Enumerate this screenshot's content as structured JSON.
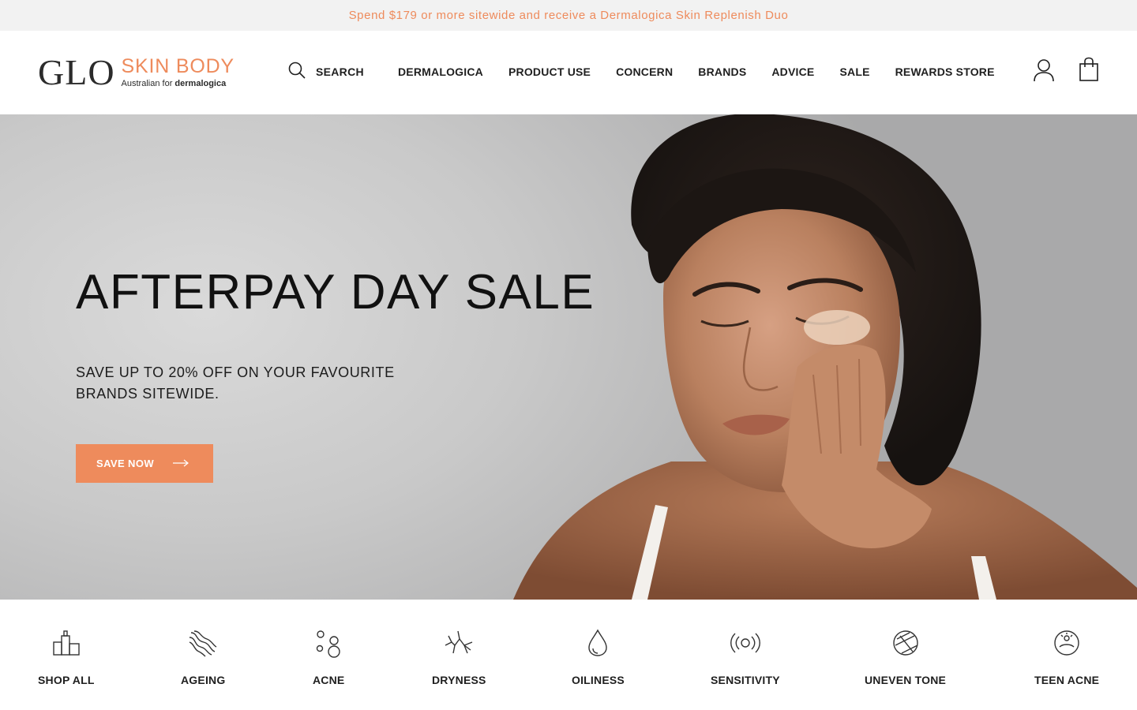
{
  "promo": {
    "text": "Spend $179 or more sitewide and receive a Dermalogica Skin Replenish Duo"
  },
  "logo": {
    "glo": "GLO",
    "skin_body": "SKIN BODY",
    "tagline_prefix": "Australian for",
    "tagline_brand": "dermalogica"
  },
  "search": {
    "label": "SEARCH",
    "icon": "search-icon"
  },
  "nav": {
    "items": [
      "DERMALOGICA",
      "PRODUCT USE",
      "CONCERN",
      "BRANDS",
      "ADVICE",
      "SALE",
      "REWARDS STORE"
    ]
  },
  "header_icons": {
    "account": "user-icon",
    "cart": "shopping-bag-icon"
  },
  "hero": {
    "title": "AFTERPAY DAY SALE",
    "subtitle": "SAVE UP TO 20% OFF ON YOUR FAVOURITE BRANDS SITEWIDE.",
    "cta_label": "SAVE NOW",
    "cta_icon": "arrow-right-icon"
  },
  "concerns": [
    {
      "label": "SHOP ALL",
      "icon": "products-icon"
    },
    {
      "label": "AGEING",
      "icon": "wavy-lines-icon"
    },
    {
      "label": "ACNE",
      "icon": "circles-icon"
    },
    {
      "label": "DRYNESS",
      "icon": "cracked-skin-icon"
    },
    {
      "label": "OILINESS",
      "icon": "droplet-icon"
    },
    {
      "label": "SENSITIVITY",
      "icon": "radiating-circle-icon"
    },
    {
      "label": "UNEVEN TONE",
      "icon": "striped-circle-icon"
    },
    {
      "label": "TEEN ACNE",
      "icon": "face-icon"
    }
  ],
  "colors": {
    "accent": "#ee8b5c",
    "text": "#1f1f1f",
    "promo_bg": "#f2f2f2"
  }
}
